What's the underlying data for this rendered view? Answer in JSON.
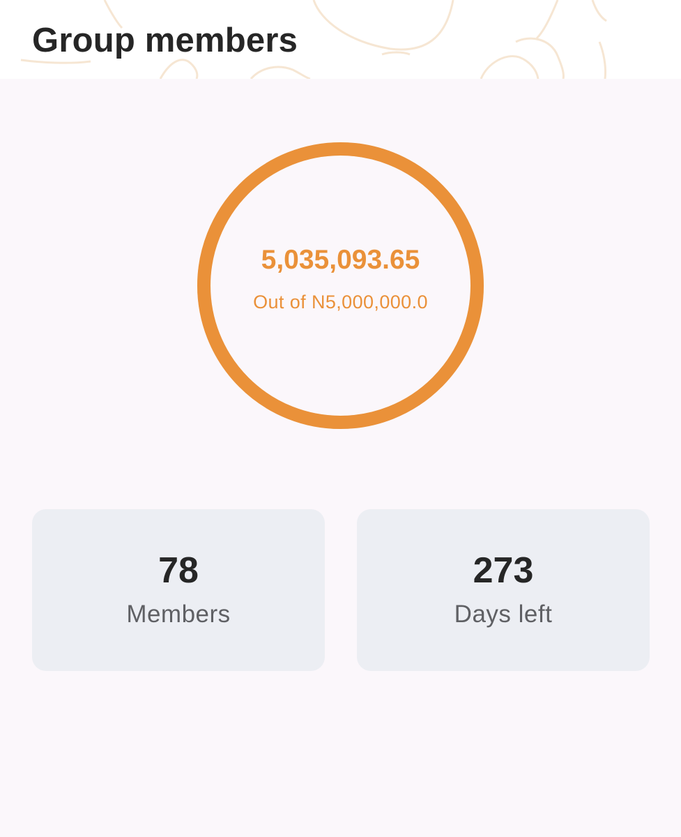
{
  "header": {
    "title": "Group members"
  },
  "progress": {
    "amount": "5,035,093.65",
    "target_label": "Out of N5,000,000.0",
    "fraction": 1.0,
    "color": "#ea9139"
  },
  "stats": [
    {
      "value": "78",
      "label": "Members"
    },
    {
      "value": "273",
      "label": "Days left"
    }
  ],
  "colors": {
    "accent": "#ea9139",
    "background": "#fbf7fb",
    "card": "#eceef3",
    "text_primary": "#262626",
    "text_secondary": "#5f6064"
  }
}
